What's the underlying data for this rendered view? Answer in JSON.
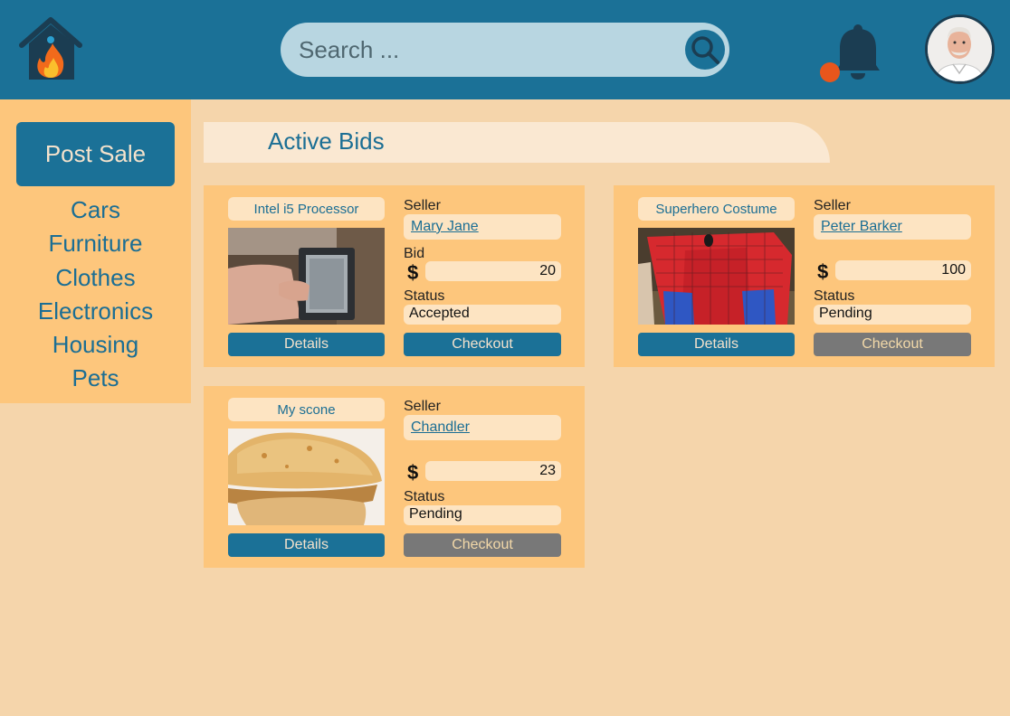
{
  "header": {
    "logo_icon": "house-flame-icon",
    "search": {
      "placeholder": "Search ...",
      "icon": "search-icon"
    },
    "notification_icon": "bell-icon",
    "notification_dot_color": "#e8561c",
    "avatar_icon": "user-avatar"
  },
  "sidebar": {
    "post_sale_label": "Post Sale",
    "categories": [
      "Cars",
      "Furniture",
      "Clothes",
      "Electronics",
      "Housing",
      "Pets"
    ]
  },
  "main": {
    "title": "Active Bids",
    "cards": [
      {
        "product": "Intel i5 Processor",
        "image_icon": "processor-photo",
        "seller_label": "Seller",
        "seller": "Mary Jane",
        "bid_label": "Bid",
        "currency_symbol": "$",
        "bid": "20",
        "status_label": "Status",
        "status": "Accepted",
        "details_label": "Details",
        "checkout_label": "Checkout",
        "checkout_enabled": true
      },
      {
        "product": "Superhero Costume",
        "image_icon": "costume-photo",
        "seller_label": "Seller",
        "seller": "Peter Barker",
        "currency_symbol": "$",
        "bid": "100",
        "status_label": "Status",
        "status": "Pending",
        "details_label": "Details",
        "checkout_label": "Checkout",
        "checkout_enabled": false
      },
      {
        "product": "My scone",
        "image_icon": "scone-photo",
        "seller_label": "Seller",
        "seller": "Chandler",
        "currency_symbol": "$",
        "bid": "23",
        "status_label": "Status",
        "status": "Pending",
        "details_label": "Details",
        "checkout_label": "Checkout",
        "checkout_enabled": false
      }
    ]
  },
  "colors": {
    "header": "#1b7197",
    "background": "#f5d5ab",
    "panel": "#fdc67c",
    "field": "#fde4c2",
    "disabled_button": "#787878"
  }
}
